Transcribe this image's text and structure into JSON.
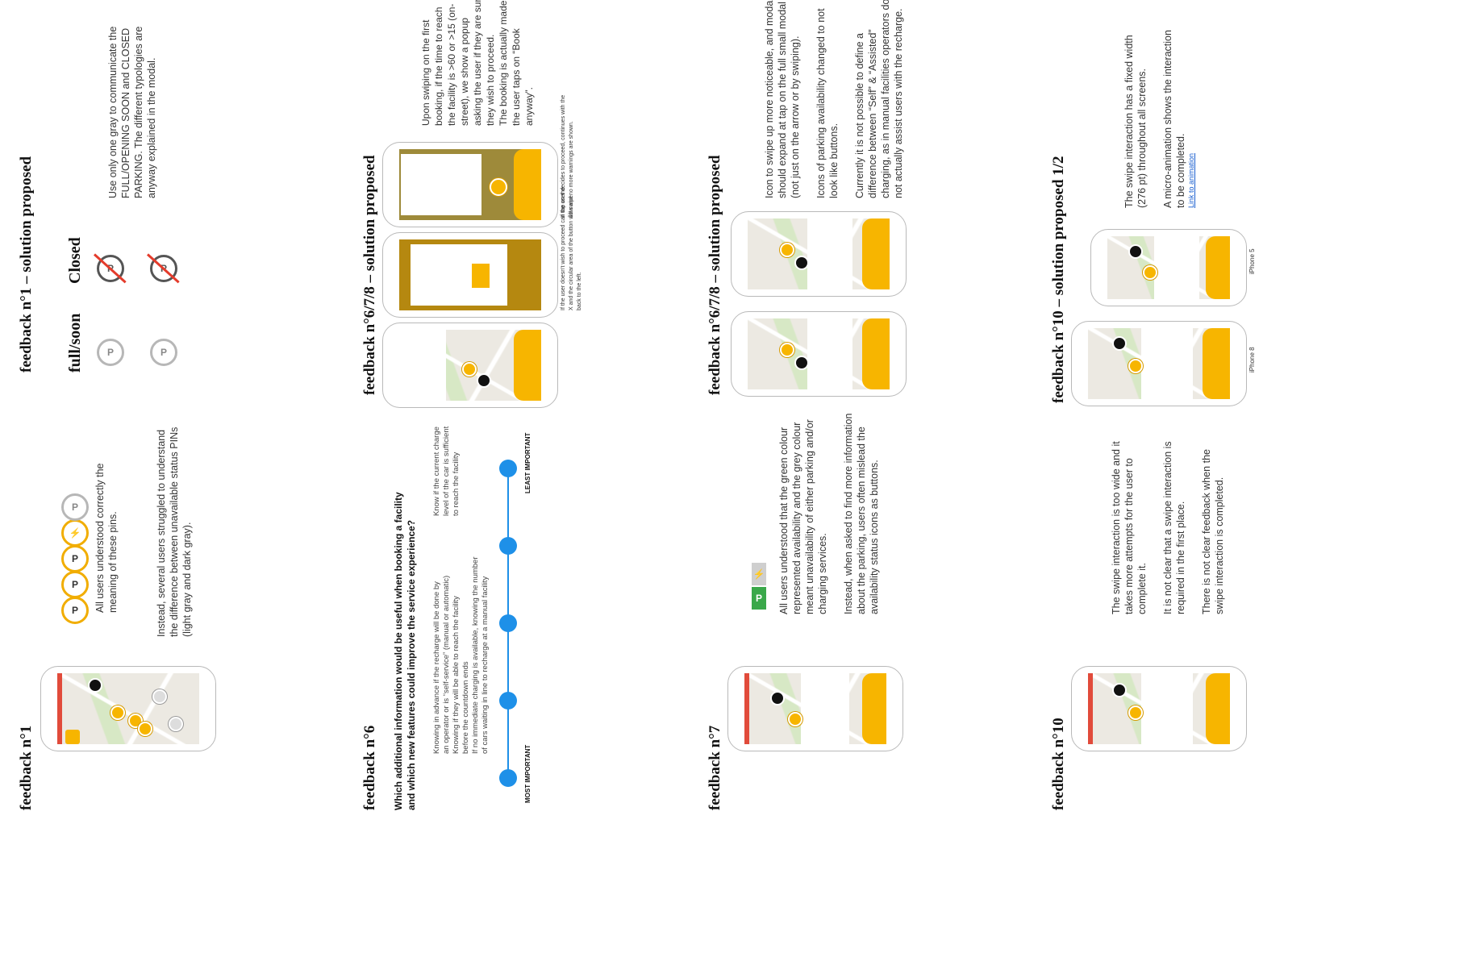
{
  "sections": {
    "fb1": {
      "title": "feedback n°1",
      "text_a": [
        "All users understood correctly the",
        "meaning of these pins."
      ],
      "text_b": [
        "Instead, several users struggled to understand",
        "the difference between unavailable status PINs",
        "(light gray and dark gray)."
      ]
    },
    "fb1_sol": {
      "title": "feedback n°1 – solution proposed",
      "label_full": "full/soon",
      "label_closed": "Closed",
      "text": [
        "Use only one gray to communicate the",
        "FULL/OPENING SOON and CLOSED",
        "PARKING. The different typologies are",
        "anyway explained in the modal."
      ]
    },
    "fb6": {
      "title": "feedback n°6",
      "question": [
        "Which additional information would be useful when booking a facility",
        "and which new features could improve the service experience?"
      ],
      "bullets_a": [
        "Knowing in advance if the recharge will be done by",
        "an operator or is “self-service” (manual or automatic)"
      ],
      "bullets_b": [
        "Knowing if they will be able to reach the facility",
        "before the countdown ends"
      ],
      "bullets_c": [
        "If no immediate charging is available, knowing the number",
        "of cars waiting in line to recharge at a manual facility"
      ],
      "bullets_d": [
        "Know if the current charge",
        "level of the car is sufficient",
        "to reach the facility"
      ],
      "most": "MOST IMPORTANT",
      "least": "LEAST IMPORTANT"
    },
    "fb678_a": {
      "title": "feedback n°6/7/8 – solution proposed",
      "text": [
        "Upon swiping on the first",
        "booking, if the time to reach",
        "the facility is >60 or >15 (on-",
        "street), we show a popup",
        "asking the user if they are sure",
        "they wish to proceed.",
        "The booking is actually made if",
        "the user taps on “Book",
        "anyway”."
      ],
      "caption_a": [
        "If the user doesn't wish to proceed can tap on the",
        "X and the circular area of the button will swipe",
        "back to the left."
      ],
      "caption_b": [
        "If the user decides to proceed, continues with the",
        "flow and no more warnings are shown."
      ]
    },
    "fb7": {
      "title": "feedback n°7",
      "text_a": [
        "All users understood that the green colour",
        "represented availability and the grey colour",
        "meant unavailability of either parking and/or",
        "charging services."
      ],
      "text_b": [
        "Instead, when asked to find more information",
        "about the parking, users often mislead the",
        "availability status icons as buttons."
      ],
      "icon_p": "P"
    },
    "fb678_b": {
      "title": "feedback n°6/7/8 – solution proposed",
      "text_a": [
        "Icon to swipe up more noticeable, and modal",
        "should expand at tap on the full small modal",
        "(not just on the arrow or by swiping)."
      ],
      "text_b": [
        "Icons of parking availability changed to not",
        "look like buttons."
      ],
      "text_c": [
        "Currently it is not possible to define a",
        "difference between “Self” & “Assisted”",
        "charging, as in manual facilities operators do",
        "not actually assist users with the recharge."
      ]
    },
    "fb10": {
      "title": "feedback n°10",
      "text_a": [
        "The swipe interaction is too wide and it",
        "takes more attempts for the user to",
        "complete it."
      ],
      "text_b": [
        "It is not clear that a swipe interaction is",
        "required in the first place."
      ],
      "text_c": [
        "There is not clear feedback when the",
        "swipe interaction is completed."
      ]
    },
    "fb10_sol": {
      "title": "feedback n°10 – solution proposed 1/2",
      "text_a": [
        "The swipe interaction has a fixed width",
        "(276 pt) throughout all screens."
      ],
      "text_b": [
        "A micro-animation shows the interaction",
        "to be completed."
      ],
      "link": "Link to animation",
      "device_a": "iPhone 8",
      "device_b": "iPhone 5"
    }
  },
  "colors": {
    "accent": "#f7b500",
    "timeline": "#1e90e8",
    "alert": "#e43b2b",
    "available": "#3aa84a"
  }
}
